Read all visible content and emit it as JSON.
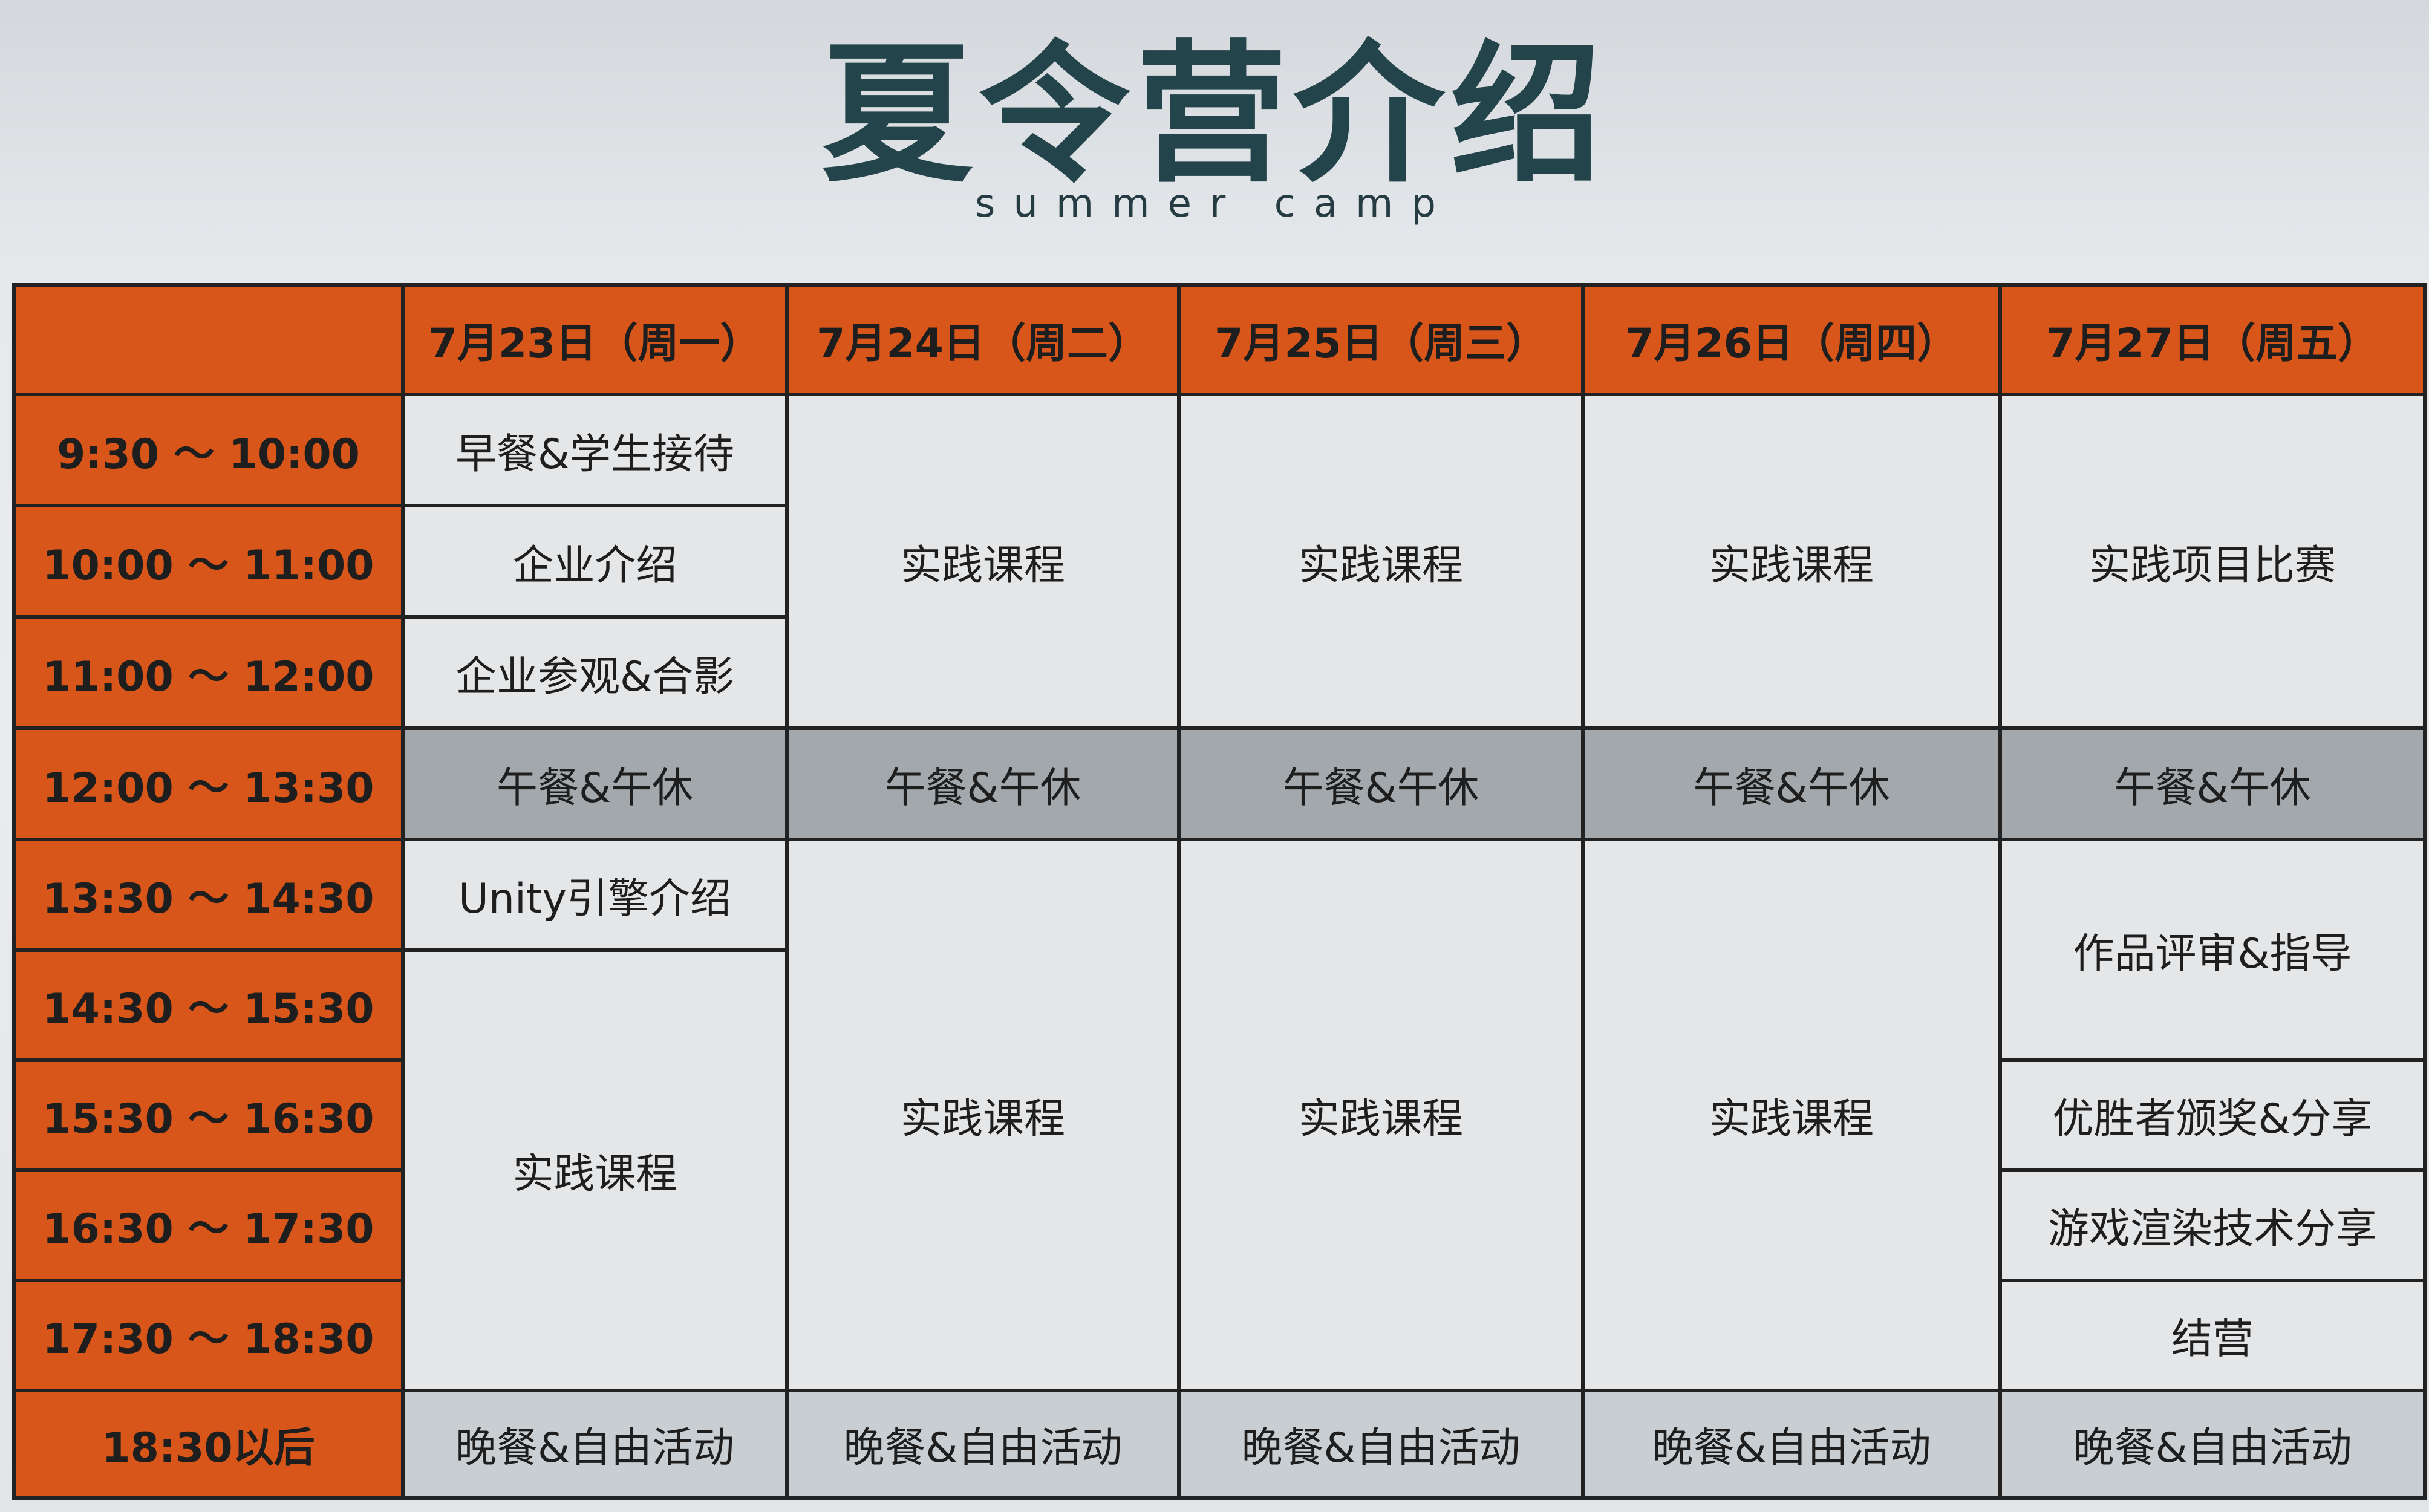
{
  "title": "夏令营介绍",
  "subtitle": "summer camp",
  "days": [
    "7月23日（周一）",
    "7月24日（周二）",
    "7月25日（周三）",
    "7月26日（周四）",
    "7月27日（周五）"
  ],
  "times": [
    "9:30 ～ 10:00",
    "10:00 ～ 11:00",
    "11:00 ～ 12:00",
    "12:00 ～ 13:30",
    "13:30 ～ 14:30",
    "14:30 ～ 15:30",
    "15:30 ～ 16:30",
    "16:30 ～ 17:30",
    "17:30 ～ 18:30",
    "18:30以后"
  ],
  "day1": {
    "breakfast": "早餐&学生接待",
    "company_intro": "企业介绍",
    "visit": "企业参观&合影",
    "unity": "Unity引擎介绍",
    "practice": "实践课程"
  },
  "day2": {
    "morning": "实践课程",
    "afternoon": "实践课程"
  },
  "day3": {
    "morning": "实践课程",
    "afternoon": "实践课程"
  },
  "day4": {
    "morning": "实践课程",
    "afternoon": "实践课程"
  },
  "day5": {
    "morning": "实践项目比赛",
    "review": "作品评审&指导",
    "award": "优胜者颁奖&分享",
    "rendering": "游戏渲染技术分享",
    "closing": "结营"
  },
  "lunch": "午餐&午休",
  "dinner": "晚餐&自由活动"
}
